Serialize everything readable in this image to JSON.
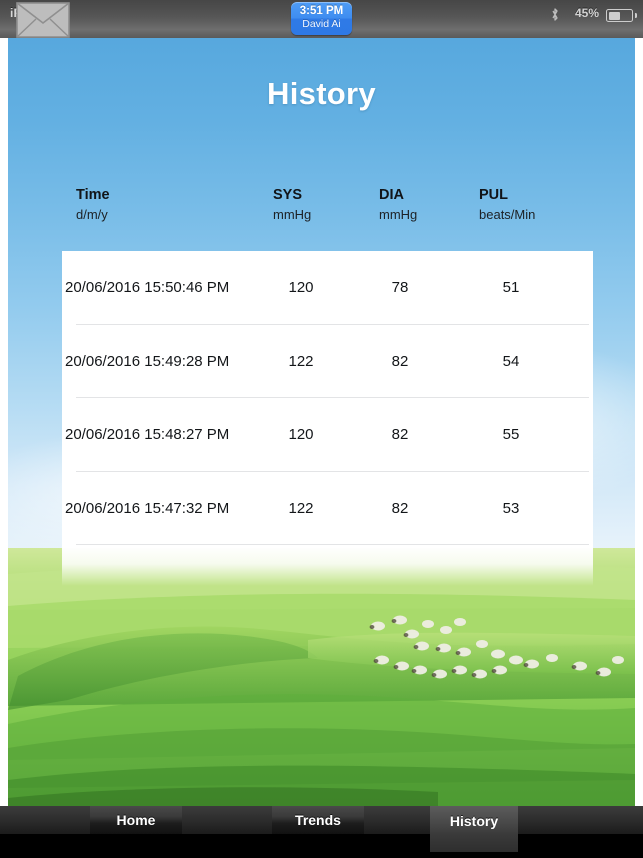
{
  "statusbar": {
    "device_label": "iPad",
    "wifi_icon": "wifi-icon",
    "mail_icon": "envelope-icon",
    "bluetooth_icon": "bluetooth-icon",
    "battery_percent": "45%",
    "battery_icon": "battery-icon",
    "time_badge": {
      "time": "3:51 PM",
      "user": "David Ai"
    }
  },
  "app": {
    "title": "History",
    "accent_color": "#57a8de",
    "card_color": "#ffffff",
    "table": {
      "headers": [
        {
          "main": "Time",
          "sub": "d/m/y"
        },
        {
          "main": "SYS",
          "sub": "mmHg"
        },
        {
          "main": "DIA",
          "sub": "mmHg"
        },
        {
          "main": "PUL",
          "sub": "beats/Min"
        }
      ],
      "rows": [
        {
          "time": "20/06/2016 15:50:46 PM",
          "sys": "120",
          "dia": "78",
          "pul": "51"
        },
        {
          "time": "20/06/2016 15:49:28 PM",
          "sys": "122",
          "dia": "82",
          "pul": "54"
        },
        {
          "time": "20/06/2016 15:48:27 PM",
          "sys": "120",
          "dia": "82",
          "pul": "55"
        },
        {
          "time": "20/06/2016 15:47:32 PM",
          "sys": "122",
          "dia": "82",
          "pul": "53"
        }
      ]
    }
  },
  "tabbar": {
    "tabs": [
      {
        "label": "Home",
        "selected": false
      },
      {
        "label": "Trends",
        "selected": false
      },
      {
        "label": "History",
        "selected": true
      }
    ]
  }
}
